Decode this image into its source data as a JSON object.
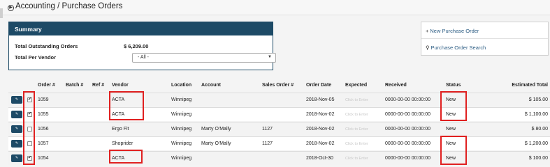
{
  "breadcrumb": "Accounting / Purchase Orders",
  "summary": {
    "title": "Summary",
    "total_outstanding_label": "Total Outstanding Orders",
    "total_outstanding_value": "$ 6,209.00",
    "per_vendor_label": "Total Per Vendor",
    "per_vendor_selected": "- All -"
  },
  "actions": {
    "new_po": "New Purchase Order",
    "search_po": "Purchase Order Search"
  },
  "table": {
    "headers": {
      "order": "Order #",
      "batch": "Batch #",
      "ref": "Ref #",
      "vendor": "Vendor",
      "location": "Location",
      "account": "Account",
      "sales_order": "Sales Order #",
      "order_date": "Order Date",
      "expected": "Expected",
      "received": "Received",
      "status": "Status",
      "estimated_total": "Estimated Total"
    },
    "rows": [
      {
        "checked": true,
        "order": "1059",
        "batch": "",
        "ref": "",
        "vendor": "ACTA",
        "location": "Winnipeg",
        "account": "",
        "sales_order": "",
        "order_date": "2018-Nov-05",
        "expected": "Click to Enter",
        "received": "0000-00-00 00:00:00",
        "status": "New",
        "estimated_total": "$ 105.00"
      },
      {
        "checked": true,
        "order": "1055",
        "batch": "",
        "ref": "",
        "vendor": "ACTA",
        "location": "Winnipeg",
        "account": "",
        "sales_order": "",
        "order_date": "2018-Nov-02",
        "expected": "Click to Enter",
        "received": "0000-00-00 00:00:00",
        "status": "New",
        "estimated_total": "$ 1,100.00"
      },
      {
        "checked": false,
        "order": "1056",
        "batch": "",
        "ref": "",
        "vendor": "Ergo Fit",
        "location": "Winnipeg",
        "account": "Marty O'Mally",
        "sales_order": "1127",
        "order_date": "2018-Nov-02",
        "expected": "Click to Enter",
        "received": "0000-00-00 00:00:00",
        "status": "New",
        "estimated_total": "$ 80.00"
      },
      {
        "checked": false,
        "order": "1057",
        "batch": "",
        "ref": "",
        "vendor": "Shoprider",
        "location": "Winnipeg",
        "account": "Marty O'Mally",
        "sales_order": "1127",
        "order_date": "2018-Nov-02",
        "expected": "Click to Enter",
        "received": "0000-00-00 00:00:00",
        "status": "New",
        "estimated_total": "$ 1,200.00"
      },
      {
        "checked": true,
        "order": "1054",
        "batch": "",
        "ref": "",
        "vendor": "ACTA",
        "location": "Winnipeg",
        "account": "",
        "sales_order": "",
        "order_date": "2018-Oct-30",
        "expected": "Click to Enter",
        "received": "0000-00-00 00:00:00",
        "status": "New",
        "estimated_total": "$ 100.00"
      }
    ]
  },
  "colors": {
    "panel_header": "#1d4a66",
    "highlight": "#e02020",
    "link": "#2a5b82"
  }
}
